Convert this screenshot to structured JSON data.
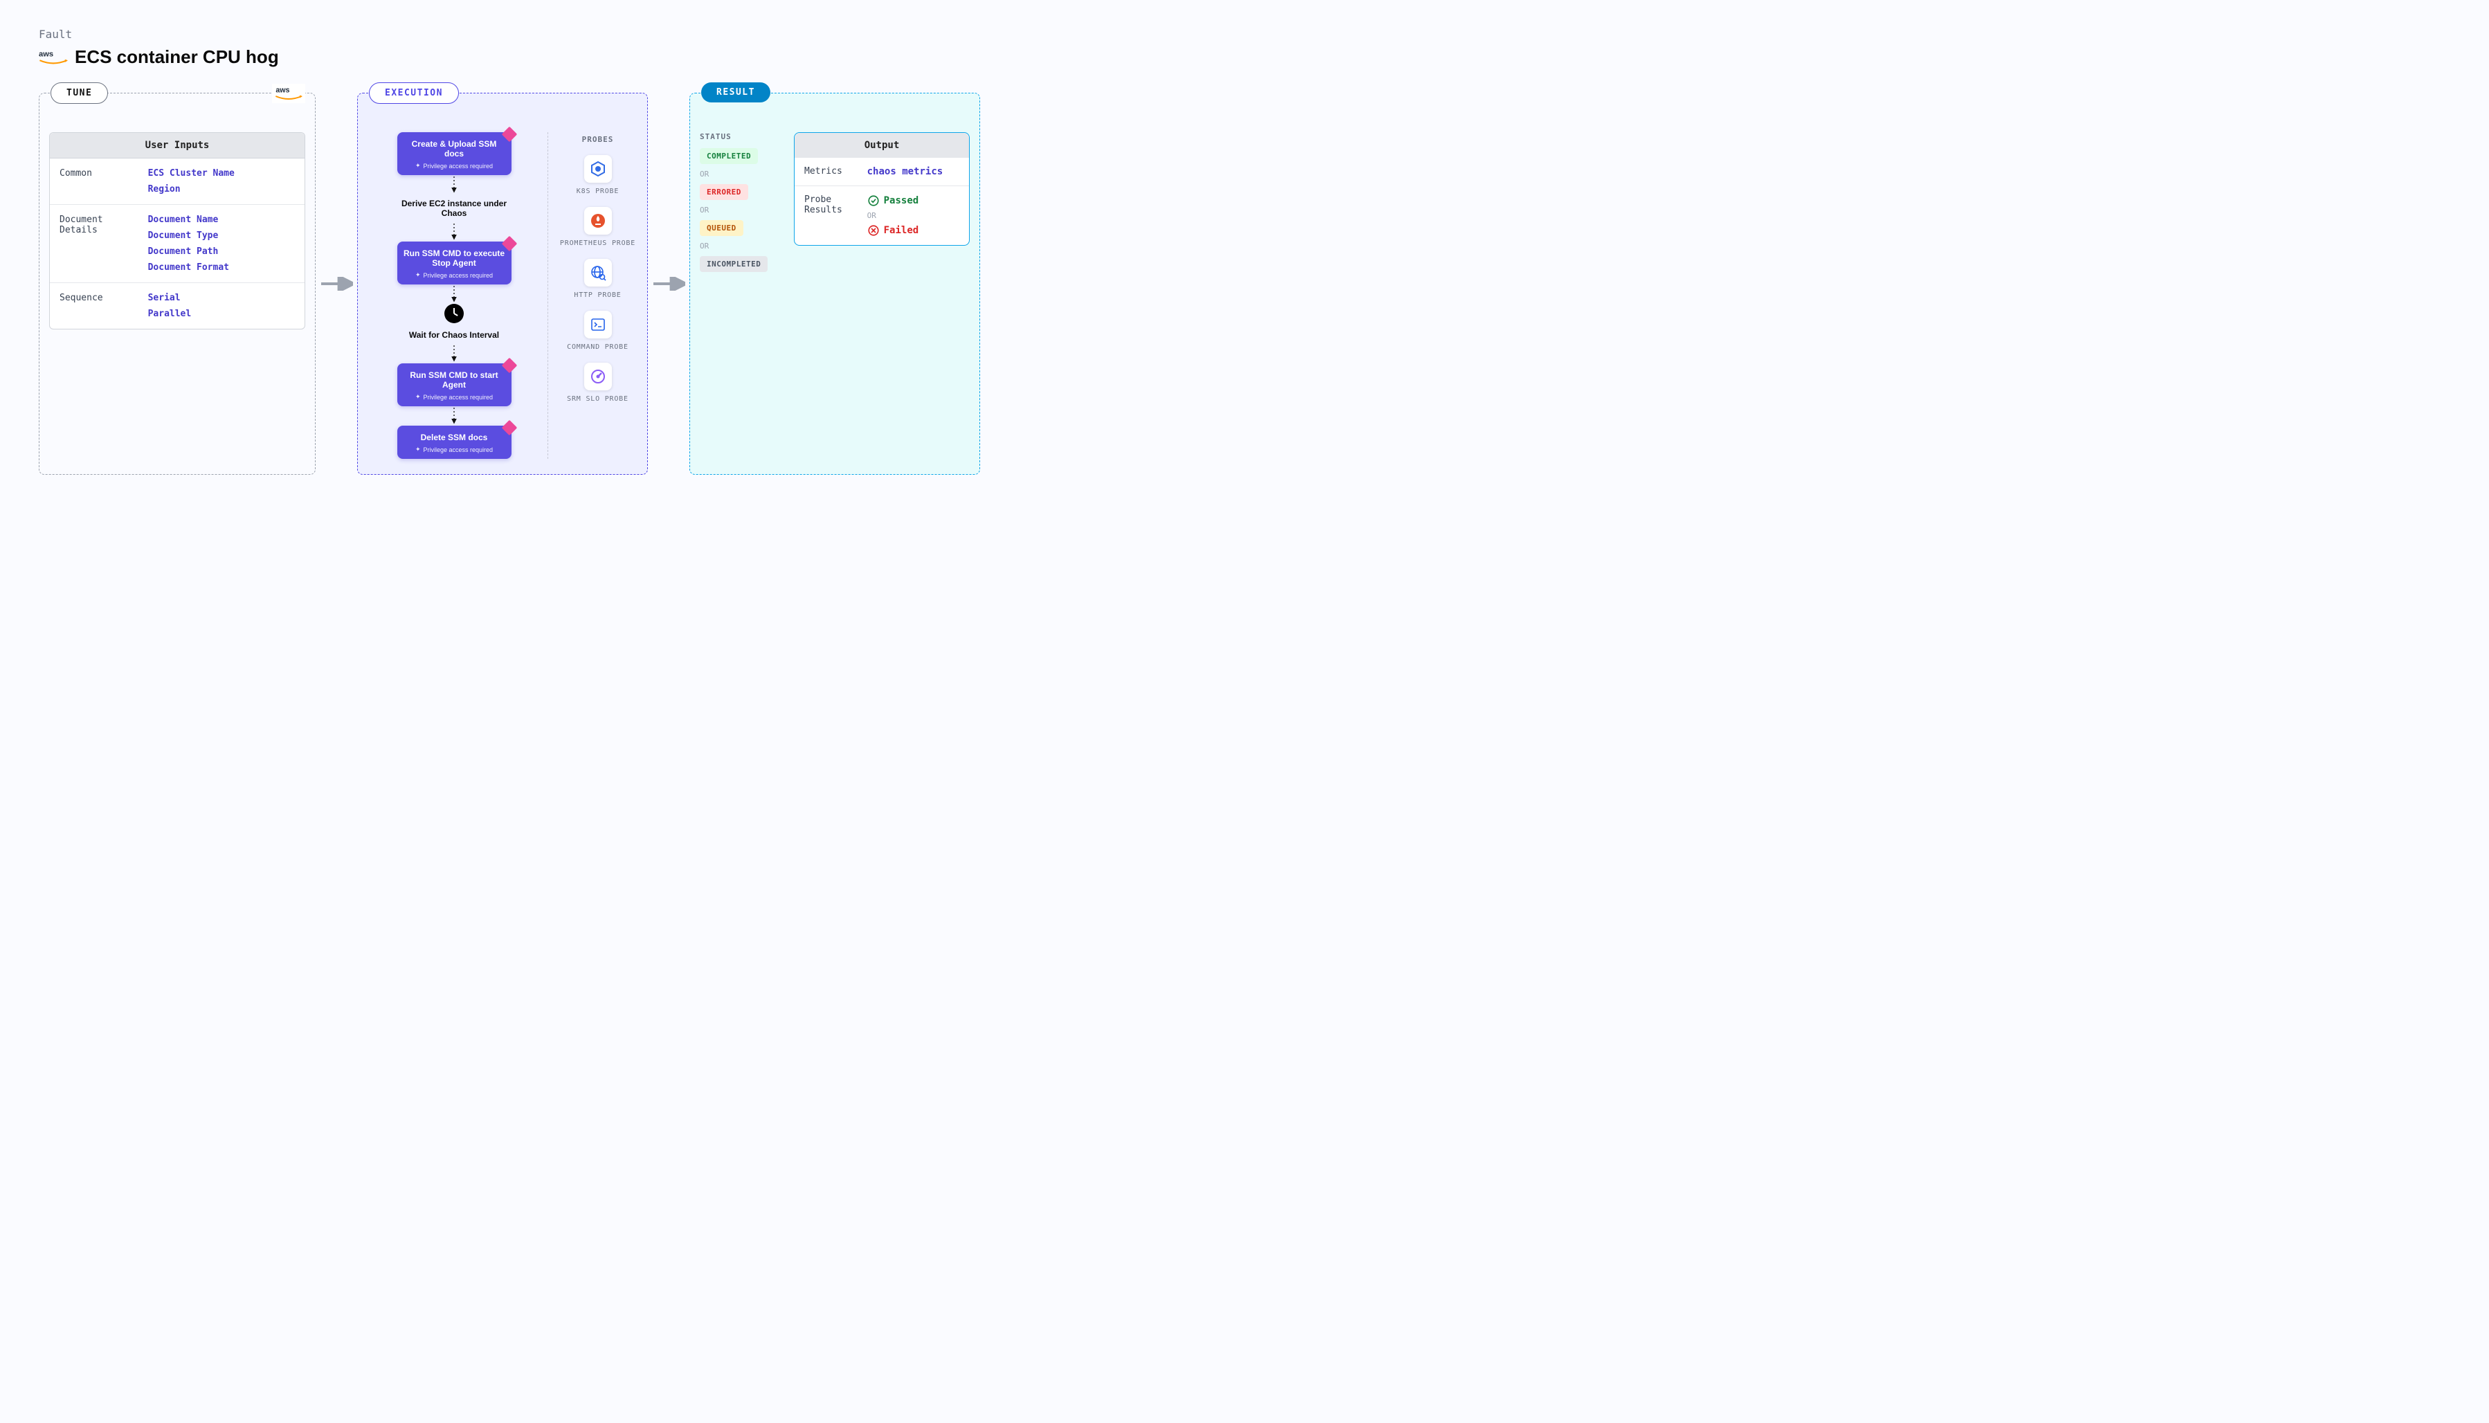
{
  "header": {
    "eyebrow": "Fault",
    "title": "ECS container CPU hog"
  },
  "tune": {
    "pill": "TUNE",
    "box_title": "User Inputs",
    "groups": [
      {
        "label": "Common",
        "values": [
          "ECS Cluster Name",
          "Region"
        ]
      },
      {
        "label": "Document Details",
        "values": [
          "Document Name",
          "Document Type",
          "Document Path",
          "Document Format"
        ]
      },
      {
        "label": "Sequence",
        "values": [
          "Serial",
          "Parallel"
        ]
      }
    ]
  },
  "exec": {
    "pill": "EXECUTION",
    "priv_label": "Privilege access required",
    "steps": {
      "s1": "Create & Upload SSM docs",
      "s2": "Derive EC2 instance under Chaos",
      "s3": "Run SSM CMD to execute Stop Agent",
      "s4": "Wait for Chaos Interval",
      "s5": "Run SSM CMD to start Agent",
      "s6": "Delete SSM docs"
    },
    "probes_header": "PROBES",
    "probes": [
      {
        "label": "K8S PROBE"
      },
      {
        "label": "PROMETHEUS PROBE"
      },
      {
        "label": "HTTP PROBE"
      },
      {
        "label": "COMMAND PROBE"
      },
      {
        "label": "SRM SLO PROBE"
      }
    ]
  },
  "result": {
    "pill": "RESULT",
    "status_header": "STATUS",
    "or": "OR",
    "statuses": {
      "completed": "COMPLETED",
      "errored": "ERRORED",
      "queued": "QUEUED",
      "incompleted": "INCOMPLETED"
    },
    "output_header": "Output",
    "metrics_label": "Metrics",
    "metrics_value": "chaos metrics",
    "probe_results_label": "Probe Results",
    "passed": "Passed",
    "failed": "Failed"
  }
}
